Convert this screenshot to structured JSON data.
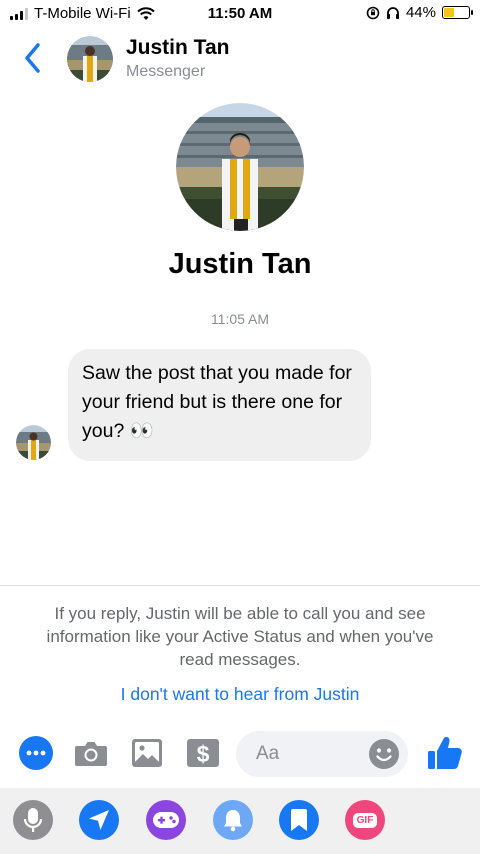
{
  "status_bar": {
    "carrier": "T-Mobile Wi-Fi",
    "time": "11:50 AM",
    "battery_text": "44%",
    "battery_level": 0.44
  },
  "header": {
    "name": "Justin Tan",
    "subtitle": "Messenger"
  },
  "profile": {
    "name": "Justin Tan"
  },
  "conversation": {
    "timestamp": "11:05 AM",
    "messages": [
      {
        "text": "Saw the post that you made for your friend but is there one for you? 👀"
      }
    ]
  },
  "notice": {
    "text": "If you reply, Justin will be able to call you and see information like your Active Status and when you've read messages.",
    "link": "I don't want to hear from Justin"
  },
  "composer": {
    "placeholder": "Aa"
  },
  "tray": {
    "gif_label": "GIF"
  },
  "colors": {
    "accent": "#1877f2",
    "gray_icon": "#8a8d91",
    "game": "#8b46e0",
    "gif": "#f0467e",
    "bell": "#6ea8f5"
  }
}
